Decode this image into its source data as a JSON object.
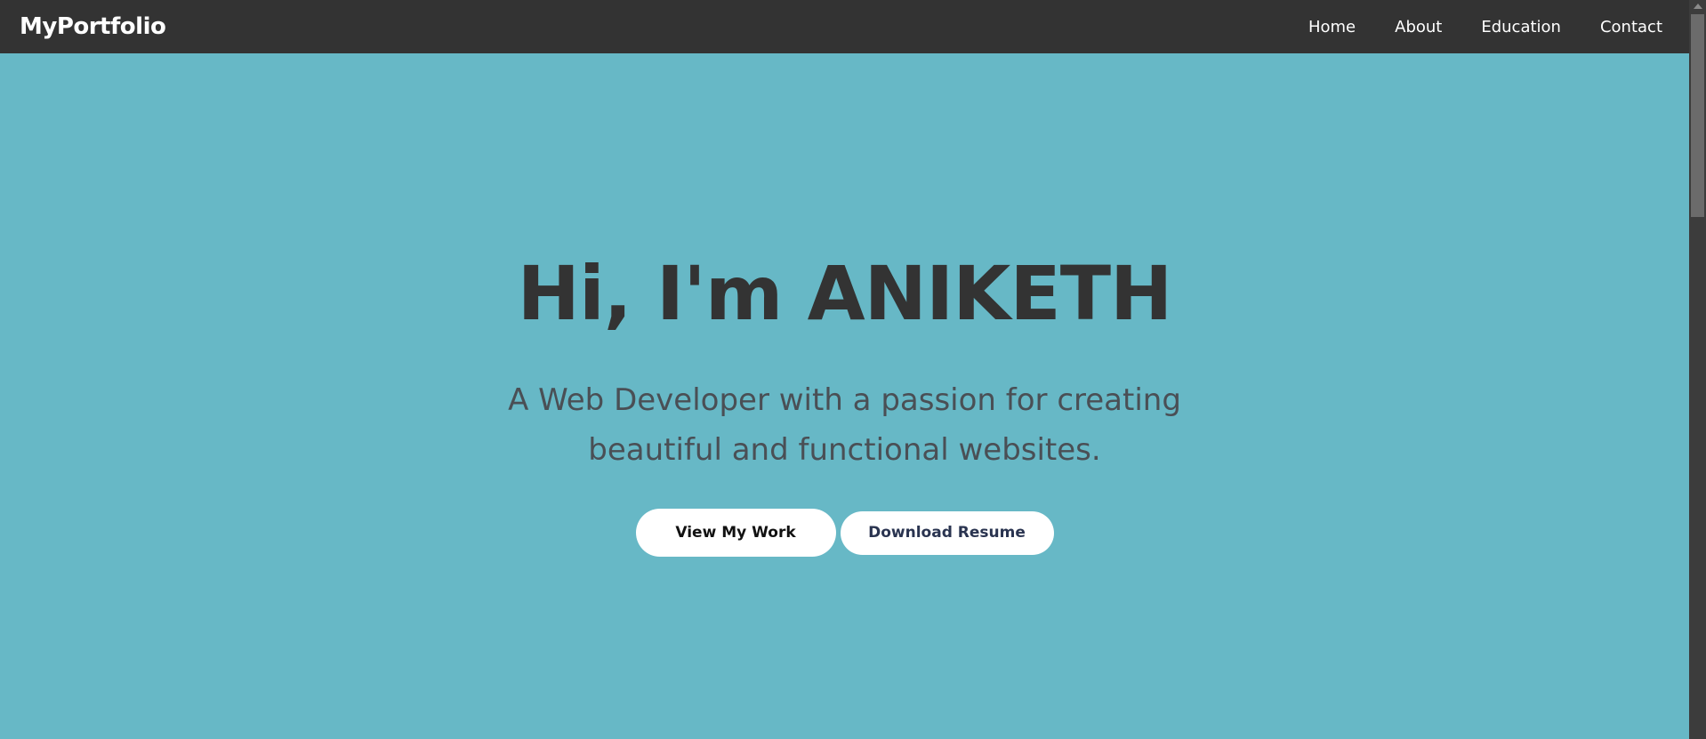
{
  "navbar": {
    "brand": "MyPortfolio",
    "links": [
      {
        "label": "Home"
      },
      {
        "label": "About"
      },
      {
        "label": "Education"
      },
      {
        "label": "Contact"
      }
    ]
  },
  "hero": {
    "title": "Hi, I'm ANIKETH",
    "subtitle": "A Web Developer with a passion for creating beautiful and functional websites.",
    "primary_button": "View My Work",
    "secondary_button": "Download Resume"
  },
  "colors": {
    "navbar_bg": "#333333",
    "hero_bg": "#67b8c6",
    "title_text": "#333333",
    "button_bg": "#ffffff"
  }
}
